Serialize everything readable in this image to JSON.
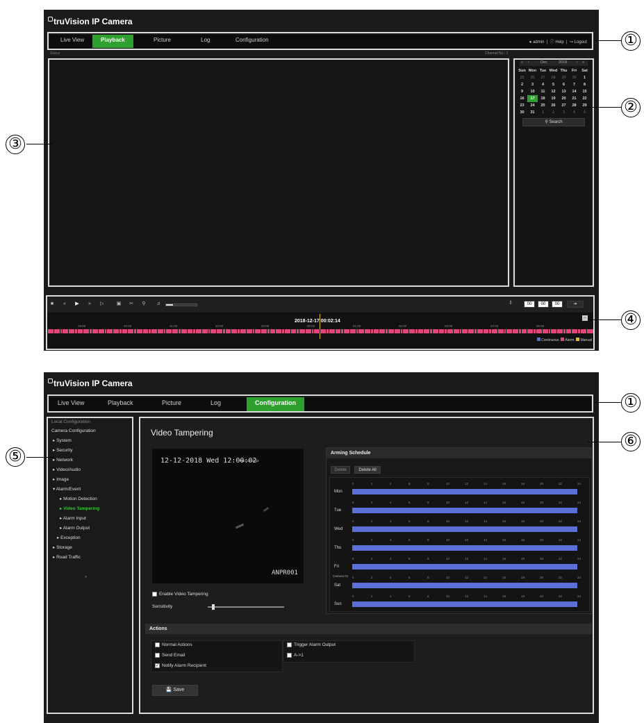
{
  "callouts": {
    "one": "①",
    "two": "②",
    "three": "③",
    "four": "④",
    "five": "⑤",
    "six": "⑥"
  },
  "top": {
    "brand": "truVision  IP Camera",
    "nav": [
      "Live View",
      "Playback",
      "Picture",
      "Log",
      "Configuration"
    ],
    "active_nav": "Playback",
    "user": {
      "admin": "admin",
      "help": "Help",
      "logout": "Logout"
    },
    "status_left": "Status",
    "channel_label": "Channel No.: 1",
    "calendar": {
      "month": "Dec",
      "year": "2018",
      "weekdays": [
        "Sun",
        "Mon",
        "Tue",
        "Wed",
        "Thu",
        "Fri",
        "Sat"
      ],
      "weeks": [
        [
          "25",
          "26",
          "27",
          "28",
          "29",
          "30",
          "1"
        ],
        [
          "2",
          "3",
          "4",
          "5",
          "6",
          "7",
          "8"
        ],
        [
          "9",
          "10",
          "11",
          "12",
          "13",
          "14",
          "15"
        ],
        [
          "16",
          "17",
          "18",
          "19",
          "20",
          "21",
          "22"
        ],
        [
          "23",
          "24",
          "25",
          "26",
          "27",
          "28",
          "29"
        ],
        [
          "30",
          "31",
          "1",
          "2",
          "3",
          "4",
          "5"
        ]
      ],
      "selected": "17",
      "search": "Search"
    },
    "timeline": {
      "timestamp": "2018-12-17 00:02:14",
      "hours": [
        "19:00",
        "20:00",
        "21:00",
        "22:00",
        "23:00",
        "00:00",
        "01:00",
        "02:00",
        "03:00",
        "04:00",
        "05:00"
      ],
      "time_boxes": [
        "00",
        "00",
        "00"
      ],
      "legend": [
        "Continuous",
        "Alarm",
        "Manual"
      ]
    },
    "colors": {
      "accent": "#2ea02e",
      "continuous": "#5b6fd6",
      "alarm": "#e0457b",
      "manual": "#e0c020"
    }
  },
  "bottom": {
    "brand": "truVision  IP Camera",
    "nav": [
      "Live View",
      "Playback",
      "Picture",
      "Log",
      "Configuration"
    ],
    "active_nav": "Configuration",
    "sidebar": {
      "local": "Local Configuration",
      "camera": "Camera Configuration",
      "items": [
        "System",
        "Security",
        "Network",
        "Video/Audio",
        "Image",
        "Alarm/Event"
      ],
      "sub_items": [
        "Motion Detection",
        "Video Tampering",
        "Alarm Input",
        "Alarm Output",
        "Exception"
      ],
      "after": [
        "Storage",
        "Road Traffic"
      ]
    },
    "page_title": "Video Tampering",
    "preview": {
      "overlay_time": "12-12-2018 Wed 12:00:02",
      "overlay_small": "Mon 15:45:32",
      "camera_name": "ANPR001"
    },
    "enable_label": "Enable Video Tampering",
    "sensitivity_label": "Sensitivity",
    "sensitivity_level": 0.05,
    "schedule": {
      "title": "Arming Schedule",
      "delete": "Delete",
      "delete_all": "Delete All",
      "days": [
        "Mon",
        "Tue",
        "Wed",
        "Thu",
        "Fri",
        "Sat",
        "Sun"
      ],
      "ticks": [
        "0",
        "2",
        "4",
        "6",
        "8",
        "10",
        "12",
        "14",
        "16",
        "18",
        "20",
        "22",
        "24"
      ],
      "fri_extra": "Camera 01"
    },
    "actions": {
      "title": "Actions",
      "normal": "Normal Actions",
      "send_email": "Send Email",
      "notify": "Notify Alarm Recipient",
      "trigger": "Trigger Alarm Output",
      "a1": "A->1",
      "save": "Save"
    }
  }
}
